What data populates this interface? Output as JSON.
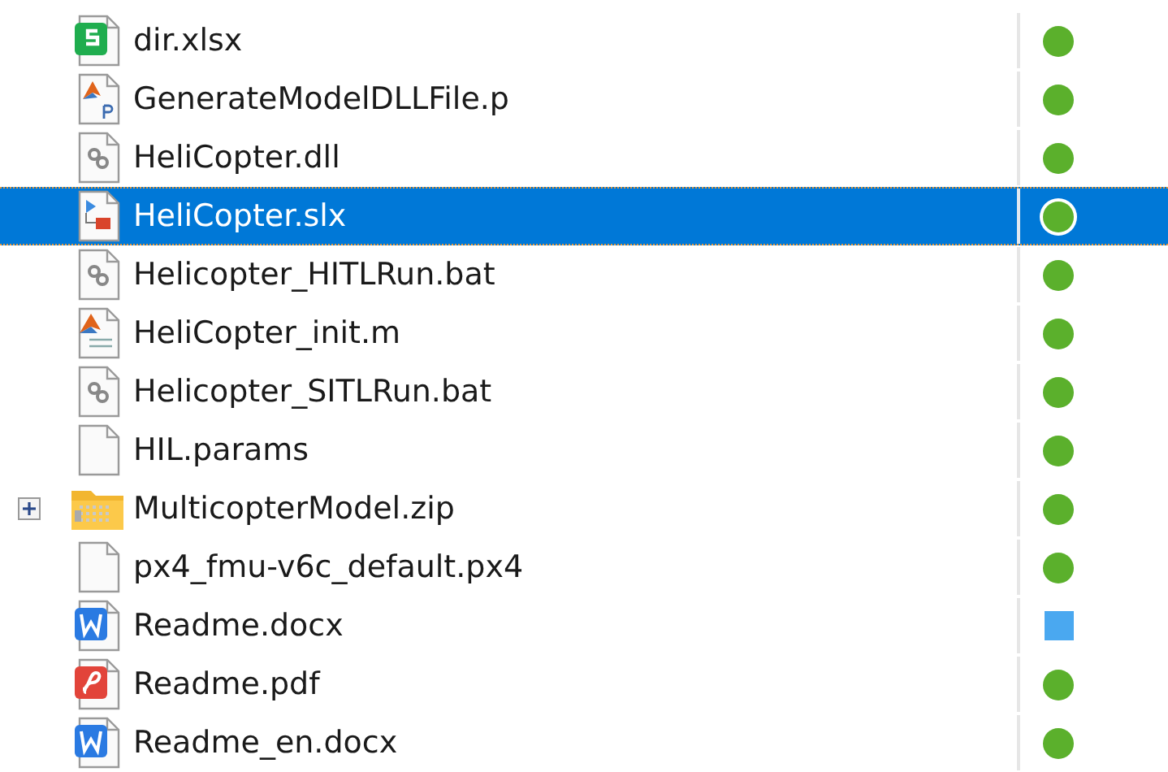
{
  "files": [
    {
      "name": "dir.xlsx",
      "kind": "sheet",
      "selected": false,
      "status": {
        "kind": "dot",
        "color": "#5bb02c"
      }
    },
    {
      "name": "GenerateModelDLLFile.p",
      "kind": "pcode",
      "selected": false,
      "status": {
        "kind": "dot",
        "color": "#5bb02c"
      }
    },
    {
      "name": "HeliCopter.dll",
      "kind": "library",
      "selected": false,
      "status": {
        "kind": "dot",
        "color": "#5bb02c"
      }
    },
    {
      "name": "HeliCopter.slx",
      "kind": "model",
      "selected": true,
      "status": {
        "kind": "dot",
        "color": "#5bb02c"
      }
    },
    {
      "name": "Helicopter_HITLRun.bat",
      "kind": "batch",
      "selected": false,
      "status": {
        "kind": "dot",
        "color": "#5bb02c"
      }
    },
    {
      "name": "HeliCopter_init.m",
      "kind": "script",
      "selected": false,
      "status": {
        "kind": "dot",
        "color": "#5bb02c"
      }
    },
    {
      "name": "Helicopter_SITLRun.bat",
      "kind": "batch",
      "selected": false,
      "status": {
        "kind": "dot",
        "color": "#5bb02c"
      }
    },
    {
      "name": "HIL.params",
      "kind": "blank",
      "selected": false,
      "status": {
        "kind": "dot",
        "color": "#5bb02c"
      }
    },
    {
      "name": "MulticopterModel.zip",
      "kind": "archive",
      "selected": false,
      "expanded": false,
      "status": {
        "kind": "dot",
        "color": "#5bb02c"
      }
    },
    {
      "name": "px4_fmu-v6c_default.px4",
      "kind": "blank",
      "selected": false,
      "status": {
        "kind": "dot",
        "color": "#5bb02c"
      }
    },
    {
      "name": "Readme.docx",
      "kind": "word",
      "selected": false,
      "status": {
        "kind": "square",
        "color": "#4aa8f0"
      }
    },
    {
      "name": "Readme.pdf",
      "kind": "pdf",
      "selected": false,
      "status": {
        "kind": "dot",
        "color": "#5bb02c"
      }
    },
    {
      "name": "Readme_en.docx",
      "kind": "word",
      "selected": false,
      "status": {
        "kind": "dot",
        "color": "#5bb02c"
      }
    }
  ]
}
